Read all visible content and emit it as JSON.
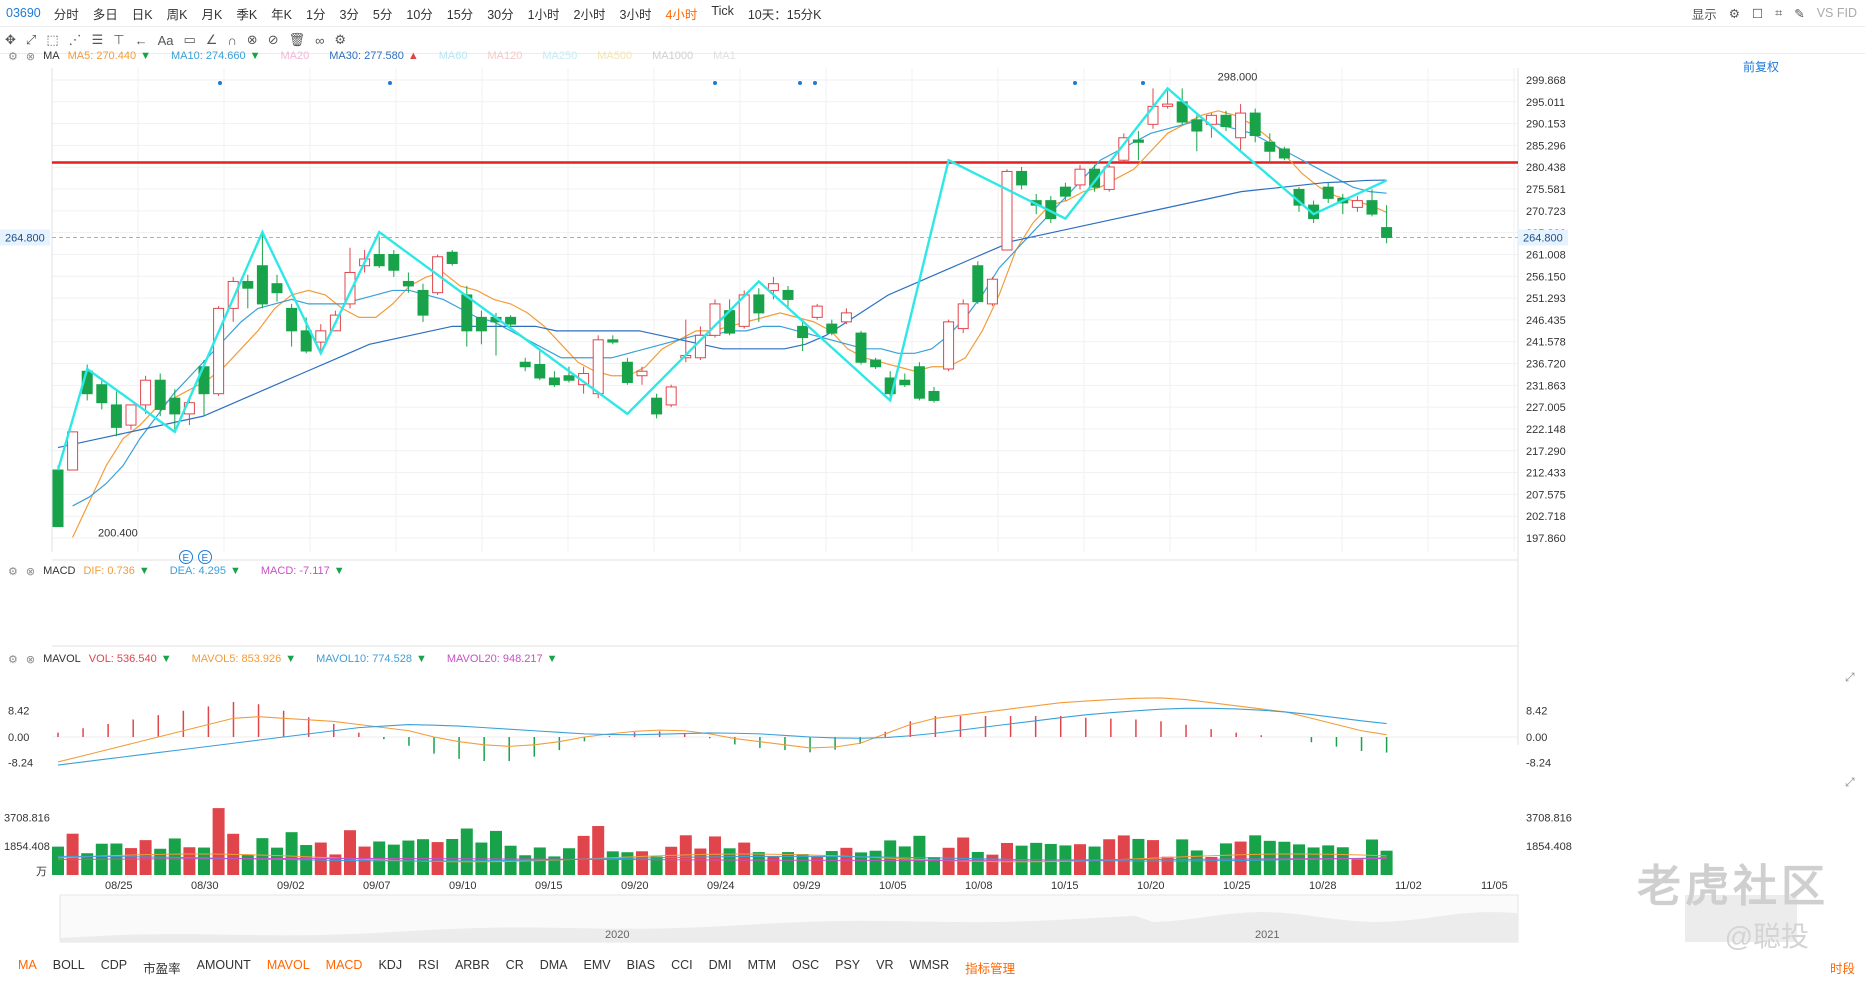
{
  "toolbar": {
    "symbol": "03690",
    "periods": [
      "分时",
      "多日",
      "日K",
      "周K",
      "月K",
      "季K",
      "年K",
      "1分",
      "3分",
      "5分",
      "10分",
      "15分",
      "30分",
      "1小时",
      "2小时",
      "3小时",
      "4小时",
      "Tick"
    ],
    "active_period": "4小时",
    "range_select": "10天：15分K",
    "display": "显示",
    "vs": "VS FID"
  },
  "draw_tools": [
    "✥",
    "⤢",
    "⬚",
    "⋰",
    "☰",
    "⊤",
    "←",
    "Aa",
    "▭",
    "∠",
    "∩",
    "⊗",
    "⊘",
    "🗑",
    "∞",
    "⚙"
  ],
  "main_legend": {
    "name": "MA",
    "items": [
      {
        "label": "MA5: 270.440",
        "color": "#f39c3a",
        "arrow": "down"
      },
      {
        "label": "MA10: 274.660",
        "color": "#3aa0d8",
        "arrow": "down"
      },
      {
        "label": "MA20",
        "color": "#f0b7d6"
      },
      {
        "label": "MA30: 277.580",
        "color": "#2e6fc0",
        "arrow": "up"
      },
      {
        "label": "MA60",
        "color": "#b9e6f3"
      },
      {
        "label": "MA120",
        "color": "#f6c9c9"
      },
      {
        "label": "MA250",
        "color": "#c6eaf5"
      },
      {
        "label": "MA500",
        "color": "#f5e3b3"
      },
      {
        "label": "MA1000",
        "color": "#cfcfcf"
      },
      {
        "label": "MA1",
        "color": "#e0e0e0"
      }
    ]
  },
  "restore_label": "前复权",
  "price_axis": [
    "299.868",
    "295.011",
    "290.153",
    "285.296",
    "280.438",
    "275.581",
    "270.723",
    "265.866",
    "261.008",
    "256.150",
    "251.293",
    "246.435",
    "241.578",
    "236.720",
    "231.863",
    "227.005",
    "222.148",
    "217.290",
    "212.433",
    "207.575",
    "202.718",
    "197.860"
  ],
  "last_price_label": "264.800",
  "high_label": "298.000",
  "low_label": "200.400",
  "event_markers": [
    "E",
    "E"
  ],
  "date_labels": [
    "08/25",
    "08/30",
    "09/02",
    "09/07",
    "09/10",
    "09/15",
    "09/20",
    "09/24",
    "09/29",
    "10/05",
    "10/08",
    "10/15",
    "10/20",
    "10/25",
    "10/28",
    "11/02",
    "11/05"
  ],
  "macd_legend": {
    "name": "MACD",
    "items": [
      {
        "label": "DIF: 0.736",
        "color": "#f39c3a",
        "arrow": "down"
      },
      {
        "label": "DEA: 4.295",
        "color": "#3aa0d8",
        "arrow": "down"
      },
      {
        "label": "MACD: -7.117",
        "color": "#c94fc9",
        "arrow": "down"
      }
    ]
  },
  "macd_axis": [
    "8.42",
    "0.00",
    "-8.24"
  ],
  "vol_legend": {
    "name": "MAVOL",
    "items": [
      {
        "label": "VOL: 536.540",
        "color": "#e0454c",
        "arrow": "down"
      },
      {
        "label": "MAVOL5: 853.926",
        "color": "#f39c3a",
        "arrow": "down"
      },
      {
        "label": "MAVOL10: 774.528",
        "color": "#3aa0d8",
        "arrow": "down"
      },
      {
        "label": "MAVOL20: 948.217",
        "color": "#c94fc9",
        "arrow": "down"
      }
    ]
  },
  "vol_axis": [
    "3708.816",
    "1854.408"
  ],
  "vol_unit": "万",
  "nav_years": [
    "2020",
    "2021"
  ],
  "indicators": [
    "MA",
    "BOLL",
    "CDP",
    "市盈率",
    "AMOUNT",
    "MAVOL",
    "MACD",
    "KDJ",
    "RSI",
    "ARBR",
    "CR",
    "DMA",
    "EMV",
    "BIAS",
    "CCI",
    "DMI",
    "MTM",
    "OSC",
    "PSY",
    "VR",
    "WMSR",
    "指标管理"
  ],
  "active_indicators": [
    "MA",
    "MAVOL",
    "MACD"
  ],
  "timezone_label": "时段",
  "watermark": "老虎社区",
  "watermark_user": "@聪投",
  "chart_data": {
    "type": "candlestick",
    "title": "03690",
    "period": "4小时",
    "ylim": [
      197.86,
      299.868
    ],
    "resistance_line": 281.5,
    "last_price": 264.8,
    "candles": [
      {
        "o": 213.0,
        "h": 214.0,
        "c": 200.4,
        "l": 200.4
      },
      {
        "o": 213.0,
        "h": 221.5,
        "c": 221.5,
        "l": 213.0
      },
      {
        "o": 235.0,
        "h": 236.5,
        "c": 230.0,
        "l": 228.5
      },
      {
        "o": 232.0,
        "h": 233.5,
        "c": 228.0,
        "l": 226.5
      },
      {
        "o": 227.5,
        "h": 230.5,
        "c": 222.5,
        "l": 220.5
      },
      {
        "o": 223.0,
        "h": 227.5,
        "c": 227.5,
        "l": 222.0
      },
      {
        "o": 227.5,
        "h": 234.0,
        "c": 233.0,
        "l": 225.5
      },
      {
        "o": 233.0,
        "h": 234.5,
        "c": 226.5,
        "l": 225.0
      },
      {
        "o": 229.0,
        "h": 231.0,
        "c": 225.5,
        "l": 222.0
      },
      {
        "o": 225.5,
        "h": 229.0,
        "c": 228.0,
        "l": 223.0
      },
      {
        "o": 236.0,
        "h": 237.5,
        "c": 230.0,
        "l": 225.0
      },
      {
        "o": 230.0,
        "h": 249.5,
        "c": 249.0,
        "l": 229.5
      },
      {
        "o": 249.0,
        "h": 256.0,
        "c": 255.0,
        "l": 246.0
      },
      {
        "o": 255.0,
        "h": 256.5,
        "c": 253.5,
        "l": 249.0
      },
      {
        "o": 258.5,
        "h": 265.8,
        "c": 250.0,
        "l": 249.0
      },
      {
        "o": 254.5,
        "h": 256.5,
        "c": 252.5,
        "l": 250.5
      },
      {
        "o": 249.0,
        "h": 250.0,
        "c": 244.0,
        "l": 240.5
      },
      {
        "o": 244.0,
        "h": 247.0,
        "c": 239.5,
        "l": 239.0
      },
      {
        "o": 241.5,
        "h": 245.5,
        "c": 244.0,
        "l": 239.0
      },
      {
        "o": 244.0,
        "h": 248.5,
        "c": 247.5,
        "l": 245.5
      },
      {
        "o": 250.0,
        "h": 262.5,
        "c": 257.0,
        "l": 249.0
      },
      {
        "o": 258.5,
        "h": 262.0,
        "c": 260.0,
        "l": 257.0
      },
      {
        "o": 261.0,
        "h": 265.0,
        "c": 258.5,
        "l": 258.0
      },
      {
        "o": 261.0,
        "h": 262.0,
        "c": 257.5,
        "l": 256.0
      },
      {
        "o": 255.0,
        "h": 257.0,
        "c": 254.0,
        "l": 252.5
      },
      {
        "o": 253.0,
        "h": 254.5,
        "c": 247.5,
        "l": 246.0
      },
      {
        "o": 252.5,
        "h": 261.0,
        "c": 260.5,
        "l": 252.0
      },
      {
        "o": 261.5,
        "h": 262.0,
        "c": 259.0,
        "l": 258.5
      },
      {
        "o": 252.0,
        "h": 254.0,
        "c": 244.0,
        "l": 240.5
      },
      {
        "o": 247.0,
        "h": 248.5,
        "c": 244.0,
        "l": 241.0
      },
      {
        "o": 247.0,
        "h": 248.0,
        "c": 246.0,
        "l": 238.5
      },
      {
        "o": 247.0,
        "h": 247.5,
        "c": 245.5,
        "l": 244.5
      },
      {
        "o": 237.0,
        "h": 238.0,
        "c": 236.0,
        "l": 235.0
      },
      {
        "o": 236.5,
        "h": 239.5,
        "c": 233.5,
        "l": 233.0
      },
      {
        "o": 233.5,
        "h": 235.0,
        "c": 232.0,
        "l": 231.5
      },
      {
        "o": 234.0,
        "h": 236.0,
        "c": 233.0,
        "l": 232.5
      },
      {
        "o": 232.0,
        "h": 236.0,
        "c": 234.5,
        "l": 230.0
      },
      {
        "o": 230.0,
        "h": 243.0,
        "c": 242.0,
        "l": 229.0
      },
      {
        "o": 242.0,
        "h": 243.0,
        "c": 241.5,
        "l": 241.0
      },
      {
        "o": 237.0,
        "h": 238.0,
        "c": 232.5,
        "l": 232.0
      },
      {
        "o": 234.0,
        "h": 236.0,
        "c": 235.0,
        "l": 232.0
      },
      {
        "o": 229.0,
        "h": 230.0,
        "c": 225.5,
        "l": 224.5
      },
      {
        "o": 227.5,
        "h": 232.0,
        "c": 231.5,
        "l": 227.0
      },
      {
        "o": 238.0,
        "h": 246.5,
        "c": 238.5,
        "l": 237.0
      },
      {
        "o": 238.0,
        "h": 245.0,
        "c": 243.0,
        "l": 237.5
      },
      {
        "o": 243.0,
        "h": 251.0,
        "c": 250.0,
        "l": 242.5
      },
      {
        "o": 248.5,
        "h": 251.0,
        "c": 243.5,
        "l": 243.0
      },
      {
        "o": 245.0,
        "h": 253.0,
        "c": 252.0,
        "l": 244.5
      },
      {
        "o": 252.0,
        "h": 253.5,
        "c": 248.0,
        "l": 246.0
      },
      {
        "o": 253.0,
        "h": 256.0,
        "c": 254.5,
        "l": 251.0
      },
      {
        "o": 253.0,
        "h": 254.0,
        "c": 251.0,
        "l": 249.0
      },
      {
        "o": 245.0,
        "h": 246.0,
        "c": 242.5,
        "l": 239.5
      },
      {
        "o": 247.0,
        "h": 250.0,
        "c": 249.5,
        "l": 246.5
      },
      {
        "o": 245.5,
        "h": 246.5,
        "c": 243.5,
        "l": 243.0
      },
      {
        "o": 246.0,
        "h": 249.0,
        "c": 248.0,
        "l": 245.5
      },
      {
        "o": 243.5,
        "h": 244.0,
        "c": 237.0,
        "l": 236.5
      },
      {
        "o": 237.5,
        "h": 238.0,
        "c": 236.0,
        "l": 235.5
      },
      {
        "o": 233.5,
        "h": 235.0,
        "c": 230.0,
        "l": 229.0
      },
      {
        "o": 233.0,
        "h": 234.5,
        "c": 232.0,
        "l": 231.5
      },
      {
        "o": 236.0,
        "h": 237.0,
        "c": 229.0,
        "l": 228.5
      },
      {
        "o": 230.5,
        "h": 231.5,
        "c": 228.5,
        "l": 228.0
      },
      {
        "o": 235.5,
        "h": 246.5,
        "c": 246.0,
        "l": 235.0
      },
      {
        "o": 244.5,
        "h": 251.0,
        "c": 250.0,
        "l": 243.5
      },
      {
        "o": 258.5,
        "h": 259.5,
        "c": 250.5,
        "l": 250.0
      },
      {
        "o": 250.0,
        "h": 256.0,
        "c": 255.5,
        "l": 249.5
      },
      {
        "o": 262.0,
        "h": 280.0,
        "c": 279.5,
        "l": 265.0
      },
      {
        "o": 279.5,
        "h": 280.5,
        "c": 276.5,
        "l": 275.5
      },
      {
        "o": 273.0,
        "h": 274.5,
        "c": 272.0,
        "l": 270.0
      },
      {
        "o": 273.0,
        "h": 274.0,
        "c": 269.0,
        "l": 268.0
      },
      {
        "o": 276.0,
        "h": 277.0,
        "c": 274.0,
        "l": 273.0
      },
      {
        "o": 276.5,
        "h": 281.0,
        "c": 280.0,
        "l": 275.5
      },
      {
        "o": 280.0,
        "h": 281.0,
        "c": 276.0,
        "l": 275.0
      },
      {
        "o": 275.5,
        "h": 281.0,
        "c": 280.5,
        "l": 275.0
      },
      {
        "o": 282.0,
        "h": 288.0,
        "c": 287.0,
        "l": 281.5
      },
      {
        "o": 286.5,
        "h": 288.5,
        "c": 286.0,
        "l": 282.0
      },
      {
        "o": 290.0,
        "h": 298.0,
        "c": 294.0,
        "l": 289.0
      },
      {
        "o": 294.0,
        "h": 297.5,
        "c": 294.5,
        "l": 293.5
      },
      {
        "o": 295.0,
        "h": 298.0,
        "c": 290.5,
        "l": 290.0
      },
      {
        "o": 291.0,
        "h": 292.0,
        "c": 288.5,
        "l": 284.0
      },
      {
        "o": 290.0,
        "h": 292.5,
        "c": 292.0,
        "l": 287.0
      },
      {
        "o": 292.0,
        "h": 293.0,
        "c": 289.5,
        "l": 288.5
      },
      {
        "o": 287.0,
        "h": 294.5,
        "c": 292.5,
        "l": 284.0
      },
      {
        "o": 292.5,
        "h": 293.5,
        "c": 287.5,
        "l": 286.0
      },
      {
        "o": 286.0,
        "h": 288.0,
        "c": 284.0,
        "l": 281.5
      },
      {
        "o": 284.5,
        "h": 285.0,
        "c": 282.5,
        "l": 282.0
      },
      {
        "o": 275.5,
        "h": 276.0,
        "c": 272.0,
        "l": 270.5
      },
      {
        "o": 272.0,
        "h": 273.0,
        "c": 269.0,
        "l": 268.0
      },
      {
        "o": 276.0,
        "h": 277.0,
        "c": 273.5,
        "l": 272.5
      },
      {
        "o": 273.5,
        "h": 274.5,
        "c": 272.5,
        "l": 270.0
      },
      {
        "o": 271.5,
        "h": 274.0,
        "c": 273.0,
        "l": 270.5
      },
      {
        "o": 273.0,
        "h": 275.5,
        "c": 270.0,
        "l": 269.5
      },
      {
        "o": 267.0,
        "h": 272.0,
        "c": 264.8,
        "l": 263.5
      }
    ],
    "ma": [
      {
        "name": "MA5",
        "color": "#f39c3a",
        "start": 1,
        "values": [
          198,
          206,
          214,
          220,
          223,
          227,
          229,
          231,
          233,
          236,
          240,
          244,
          249,
          252,
          253,
          252,
          249,
          247,
          247,
          250,
          254,
          256,
          257,
          254,
          253,
          251,
          250,
          248,
          245,
          241,
          237,
          235,
          234,
          234,
          236,
          240,
          242,
          244,
          244,
          245,
          246,
          247,
          248,
          247,
          246,
          244,
          240,
          238,
          237,
          236,
          235,
          236,
          236,
          238,
          244,
          252,
          262,
          268,
          272,
          273,
          275,
          276,
          278,
          280,
          284,
          288,
          290,
          292,
          293,
          292,
          290,
          287,
          283,
          279,
          276,
          274,
          273,
          272,
          270.4
        ]
      },
      {
        "name": "MA10",
        "color": "#3aa0d8",
        "start": 1,
        "values": [
          205,
          207,
          210,
          214,
          220,
          225,
          230,
          234,
          238,
          242,
          246,
          249,
          250,
          251,
          250,
          250,
          250,
          251,
          252,
          253,
          253,
          252,
          251,
          249,
          247,
          246,
          244,
          242,
          240,
          238,
          238,
          238,
          238,
          239,
          240,
          241,
          242,
          243,
          243,
          244,
          244,
          245,
          245,
          244,
          243,
          242,
          241,
          240,
          240,
          239,
          239,
          240,
          243,
          247,
          252,
          258,
          262,
          266,
          270,
          274,
          278,
          282,
          284,
          286,
          288,
          289,
          290,
          291,
          290,
          289,
          288,
          286,
          284,
          282,
          280,
          278,
          276,
          275,
          274.66
        ]
      },
      {
        "name": "MA30",
        "color": "#2e6fc0",
        "start": 0,
        "values": [
          218,
          219,
          220,
          221,
          222,
          223,
          224,
          225,
          227,
          229,
          231,
          233,
          235,
          237,
          239,
          241,
          242,
          243,
          244,
          245,
          245,
          245,
          245,
          245,
          244,
          244,
          244,
          244,
          244,
          243,
          242,
          241,
          240,
          240,
          240,
          240,
          241,
          243,
          246,
          249,
          252,
          254,
          256,
          258,
          260,
          262,
          264,
          265,
          266,
          267,
          268,
          269,
          270,
          271,
          272,
          273,
          274,
          275,
          275.5,
          276,
          276.5,
          277,
          277.2,
          277.5,
          277.58
        ]
      }
    ],
    "zigzag": [
      213.0,
      235.5,
      221.5,
      266.0,
      239.0,
      266.0,
      225.5,
      255.0,
      228.5,
      282.0,
      269.0,
      298.0,
      270.0,
      277.5
    ],
    "macd": {
      "dif": [
        -8,
        -6,
        -4,
        -2,
        0,
        2,
        4,
        6,
        6.5,
        6,
        5.5,
        5,
        4,
        3,
        2,
        0,
        -1.5,
        -2.5,
        -3.0,
        -2.5,
        -1.5,
        0,
        1,
        1.8,
        2.2,
        2,
        1,
        -0.5,
        -1.5,
        -2.5,
        -3.5,
        -3.2,
        -2,
        1,
        4,
        6,
        7,
        8,
        9,
        10,
        11,
        11.5,
        12,
        12.4,
        12.5,
        12,
        11,
        10,
        9,
        8,
        6,
        4,
        2,
        0.736
      ],
      "dea": [
        -9,
        -8,
        -7,
        -6,
        -5,
        -4,
        -3,
        -2,
        -1,
        0,
        1,
        2,
        3,
        3.5,
        4,
        3.8,
        3.5,
        3,
        2.5,
        2,
        1.5,
        1,
        0.8,
        0.7,
        0.9,
        1.1,
        1.3,
        1.2,
        1,
        0.5,
        0,
        -0.3,
        -0.4,
        -0.2,
        0.4,
        1.2,
        2.2,
        3.2,
        4.2,
        5.2,
        6.2,
        7.1,
        7.8,
        8.4,
        8.9,
        9.2,
        9.2,
        9,
        8.6,
        8,
        7.2,
        6.2,
        5.2,
        4.295
      ],
      "hist_range": [
        -8.24,
        8.42
      ]
    },
    "volume": {
      "ylim": [
        0,
        4500
      ],
      "mavol_levels": [
        853.926,
        774.528,
        948.217
      ]
    }
  }
}
